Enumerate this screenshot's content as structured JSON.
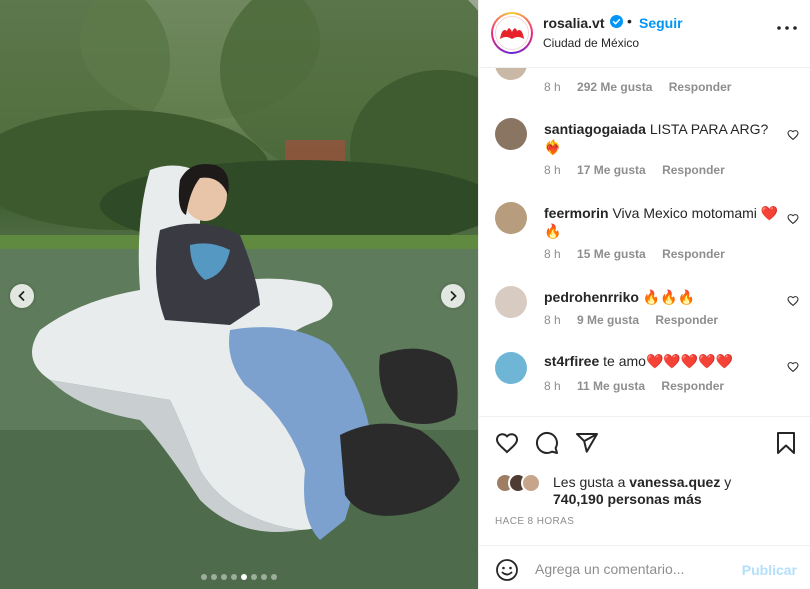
{
  "post": {
    "photo_alt": "",
    "carousel": {
      "total": 8,
      "active_index": 4
    }
  },
  "header": {
    "username": "rosalia.vt",
    "separator": "•",
    "follow_label": "Seguir",
    "location": "Ciudad de México"
  },
  "comments": [
    {
      "user": "",
      "text": "",
      "time": "8 h",
      "likes": "292 Me gusta",
      "reply": "Responder",
      "avatar_color": "#c9b8a6"
    },
    {
      "user": "santiagogaiada",
      "text": "LISTA PARA ARG? ❤️‍🔥",
      "time": "8 h",
      "likes": "17 Me gusta",
      "reply": "Responder",
      "avatar_color": "#8a7462"
    },
    {
      "user": "feermorin",
      "text": "Viva Mexico motomami ❤️🔥",
      "time": "8 h",
      "likes": "15 Me gusta",
      "reply": "Responder",
      "avatar_color": "#b79c7e"
    },
    {
      "user": "pedrohenrriko",
      "text": "🔥🔥🔥",
      "time": "8 h",
      "likes": "9 Me gusta",
      "reply": "Responder",
      "avatar_color": "#d8cbc2"
    },
    {
      "user": "st4rfiree",
      "text": "te amo❤️❤️❤️❤️❤️",
      "time": "8 h",
      "likes": "11 Me gusta",
      "reply": "Responder",
      "avatar_color": "#6fb6d6"
    }
  ],
  "likes": {
    "prefix": "Les gusta a",
    "user": "vanessa.quez",
    "joiner": "y",
    "others": "740,190 personas más"
  },
  "timestamp": "HACE 8 HORAS",
  "add_comment": {
    "placeholder": "Agrega un comentario...",
    "publish_label": "Publicar"
  },
  "colors": {
    "accent": "#0095f6",
    "publish_disabled": "#b2dffc",
    "heart_red": "#ed4956",
    "muted": "#8e8e8e"
  },
  "icons": [
    "chevron-left-icon",
    "chevron-right-icon",
    "verified-icon",
    "more-icon",
    "heart-icon",
    "comment-icon",
    "share-icon",
    "bookmark-icon",
    "emoji-icon"
  ]
}
